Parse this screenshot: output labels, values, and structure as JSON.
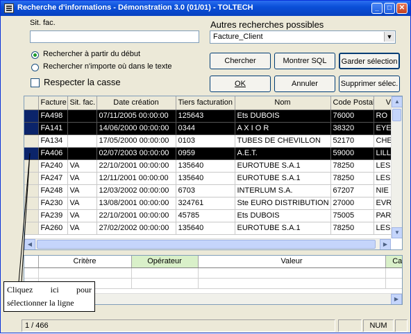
{
  "window": {
    "title": "Recherche d'informations - Démonstration 3.0 (01/01) - TOLTECH"
  },
  "search": {
    "sit_fac_label": "Sit. fac.",
    "sit_fac_value": "",
    "radio_start_label": "Rechercher à partir du début",
    "radio_anywhere_label": "Rechercher n'importe où dans le texte",
    "respect_case_label": "Respecter la casse"
  },
  "other_searches": {
    "label": "Autres recherches possibles",
    "selected": "Facture_Client"
  },
  "buttons": {
    "chercher": "Chercher",
    "montrer_sql": "Montrer SQL",
    "garder_selection": "Garder sélection",
    "ok": "OK",
    "annuler": "Annuler",
    "supprimer_selec": "Supprimer sélec."
  },
  "table": {
    "columns": [
      "Facture",
      "Sit. fac.",
      "Date création",
      "Tiers facturation",
      "Nom",
      "Code Postal",
      "Vi"
    ],
    "rows": [
      {
        "facture": "FA498",
        "sit": "",
        "date": "07/11/2005  00:00:00",
        "tiers": "125643",
        "nom": "Ets DUBOIS",
        "cp": "76000",
        "ville": "RO",
        "selected": true
      },
      {
        "facture": "FA141",
        "sit": "",
        "date": "14/06/2000  00:00:00",
        "tiers": "0344",
        "nom": "A X I O R",
        "cp": "38320",
        "ville": "EYE",
        "selected": true
      },
      {
        "facture": "FA134",
        "sit": "",
        "date": "17/05/2000  00:00:00",
        "tiers": "0103",
        "nom": "TUBES DE CHEVILLON",
        "cp": "52170",
        "ville": "CHE",
        "selected": false
      },
      {
        "facture": "FA406",
        "sit": "",
        "date": "02/07/2003  00:00:00",
        "tiers": "0959",
        "nom": "A.E.T.",
        "cp": "59000",
        "ville": "LILL",
        "selected": true
      },
      {
        "facture": "FA240",
        "sit": "VA",
        "date": "22/10/2001  00:00:00",
        "tiers": "135640",
        "nom": "EUROTUBE S.A.1",
        "cp": "78250",
        "ville": "LES",
        "selected": false
      },
      {
        "facture": "FA247",
        "sit": "VA",
        "date": "12/11/2001  00:00:00",
        "tiers": "135640",
        "nom": "EUROTUBE S.A.1",
        "cp": "78250",
        "ville": "LES",
        "selected": false
      },
      {
        "facture": "FA248",
        "sit": "VA",
        "date": "12/03/2002  00:00:00",
        "tiers": "6703",
        "nom": "INTERLUM S.A.",
        "cp": "67207",
        "ville": "NIE",
        "selected": false
      },
      {
        "facture": "FA230",
        "sit": "VA",
        "date": "13/08/2001  00:00:00",
        "tiers": "324761",
        "nom": "Ste EURO DISTRIBUTION",
        "cp": "27000",
        "ville": "EVR",
        "selected": false
      },
      {
        "facture": "FA239",
        "sit": "VA",
        "date": "22/10/2001  00:00:00",
        "tiers": "45785",
        "nom": "Ets DUBOIS",
        "cp": "75005",
        "ville": "PAR",
        "selected": false
      },
      {
        "facture": "FA260",
        "sit": "VA",
        "date": "27/02/2002  00:00:00",
        "tiers": "135640",
        "nom": "EUROTUBE S.A.1",
        "cp": "78250",
        "ville": "LES",
        "selected": false
      }
    ]
  },
  "criteria": {
    "columns": [
      "Critère",
      "Opérateur",
      "Valeur",
      "Cas"
    ],
    "header_colors": [
      "#ffffff",
      "#d9f0c9",
      "#ffffff",
      "#d9f0c9"
    ]
  },
  "callout": {
    "line1_words": [
      "Cliquez",
      "ici",
      "pour"
    ],
    "line2": "sélectionner la ligne"
  },
  "status": {
    "record": "1 / 466",
    "num": "NUM"
  }
}
